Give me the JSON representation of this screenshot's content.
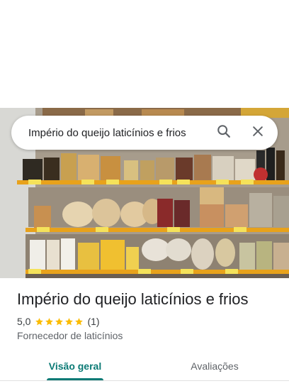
{
  "search": {
    "query": "Império do queijo laticínios e frios",
    "search_icon": "search-icon",
    "close_icon": "close-icon"
  },
  "place": {
    "name": "Império do queijo laticínios e frios",
    "rating": "5,0",
    "stars": 5,
    "review_count": "(1)",
    "category": "Fornecedor de laticínios"
  },
  "tabs": [
    {
      "label": "Visão geral",
      "selected": true
    },
    {
      "label": "Avaliações",
      "selected": false
    }
  ],
  "colors": {
    "accent": "#0b7a75",
    "star": "#fbbc04",
    "shelf": "#e8a21b"
  }
}
